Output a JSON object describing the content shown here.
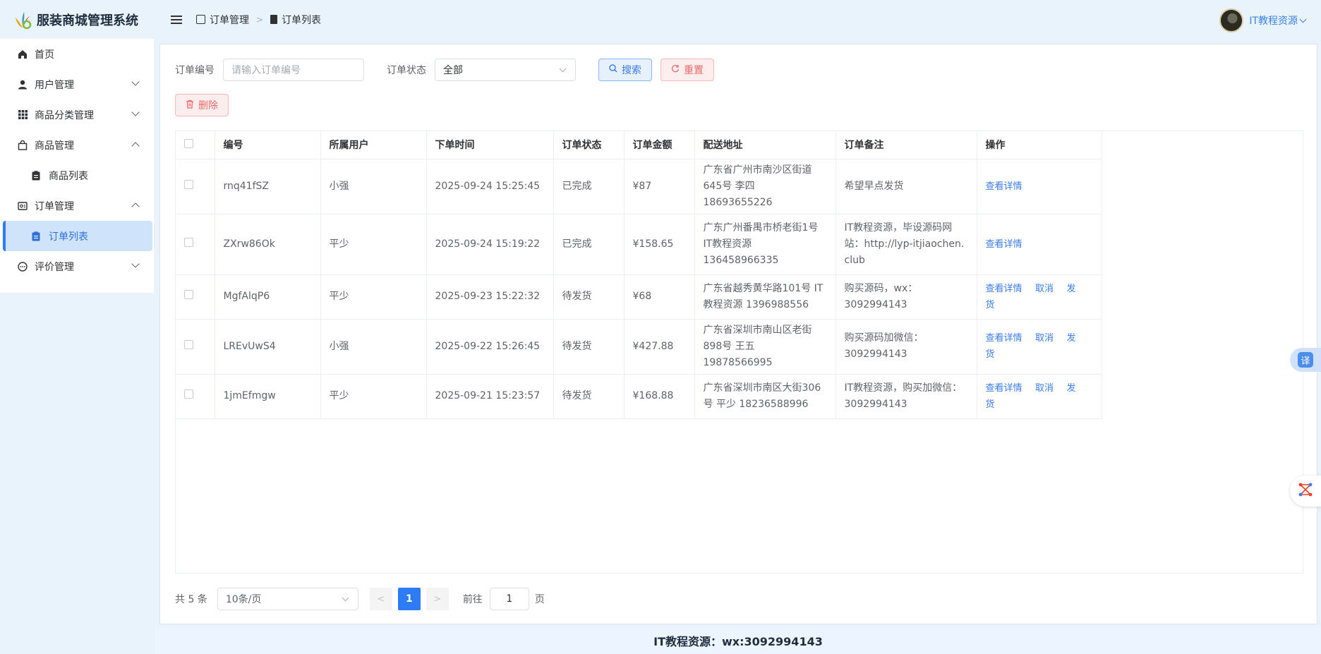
{
  "app": {
    "title": "服装商城管理系统"
  },
  "sidebar": {
    "items": [
      {
        "label": "首页",
        "icon": "home-icon"
      },
      {
        "label": "用户管理",
        "icon": "user-icon",
        "expanded": false
      },
      {
        "label": "商品分类管理",
        "icon": "grid-icon",
        "expanded": false
      },
      {
        "label": "商品管理",
        "icon": "bag-icon",
        "expanded": true,
        "children": [
          {
            "label": "商品列表",
            "icon": "clipboard-icon"
          }
        ]
      },
      {
        "label": "订单管理",
        "icon": "order-icon",
        "expanded": true,
        "children": [
          {
            "label": "订单列表",
            "icon": "clipboard-icon",
            "active": true
          }
        ]
      },
      {
        "label": "评价管理",
        "icon": "comment-icon",
        "expanded": false
      }
    ]
  },
  "header": {
    "breadcrumb": [
      "订单管理",
      "订单列表"
    ],
    "user_name": "IT教程资源"
  },
  "filter": {
    "order_no_label": "订单编号",
    "order_no_placeholder": "请输入订单编号",
    "status_label": "订单状态",
    "status_value": "全部",
    "search_label": "搜索",
    "reset_label": "重置",
    "delete_label": "删除"
  },
  "table": {
    "columns": [
      "编号",
      "所属用户",
      "下单时间",
      "订单状态",
      "订单金额",
      "配送地址",
      "订单备注",
      "操作"
    ],
    "rows": [
      {
        "no": "rnq41fSZ",
        "user": "小强",
        "time": "2025-09-24 15:25:45",
        "status": "已完成",
        "amount": "¥87",
        "address": "广东省广州市南沙区街道645号 李四 18693655226",
        "remark": "希望早点发货",
        "ops": [
          "查看详情"
        ]
      },
      {
        "no": "ZXrw86Ok",
        "user": "平少",
        "time": "2025-09-24 15:19:22",
        "status": "已完成",
        "amount": "¥158.65",
        "address": "广东广州番禺市桥老街1号 IT教程资源 136458966335",
        "remark": "IT教程资源，毕设源码网站：http://lyp-itjiaochen.club",
        "ops": [
          "查看详情"
        ]
      },
      {
        "no": "MgfAlqP6",
        "user": "平少",
        "time": "2025-09-23 15:22:32",
        "status": "待发货",
        "amount": "¥68",
        "address": "广东省越秀黄华路101号 IT教程资源 1396988556",
        "remark": "购买源码，wx：3092994143",
        "ops": [
          "查看详情",
          "取消",
          "发货"
        ]
      },
      {
        "no": "LREvUwS4",
        "user": "小强",
        "time": "2025-09-22 15:26:45",
        "status": "待发货",
        "amount": "¥427.88",
        "address": "广东省深圳市南山区老街898号 王五 19878566995",
        "remark": "购买源码加微信：3092994143",
        "ops": [
          "查看详情",
          "取消",
          "发货"
        ]
      },
      {
        "no": "1jmEfmgw",
        "user": "平少",
        "time": "2025-09-21 15:23:57",
        "status": "待发货",
        "amount": "¥168.88",
        "address": "广东省深圳市南区大街306号 平少 18236588996",
        "remark": "IT教程资源，购买加微信：3092994143",
        "ops": [
          "查看详情",
          "取消",
          "发货"
        ]
      }
    ]
  },
  "pagination": {
    "total_text": "共 5 条",
    "page_size": "10条/页",
    "current_page": "1",
    "goto_label": "前往",
    "goto_value": "1",
    "page_suffix": "页"
  },
  "footer": {
    "text": "IT教程资源：wx:3092994143"
  },
  "floating": {
    "translate_label": "译"
  },
  "colors": {
    "accent": "#2d7cf6",
    "sidebar_bg": "#e8f3fc",
    "danger": "#e86a6a"
  }
}
